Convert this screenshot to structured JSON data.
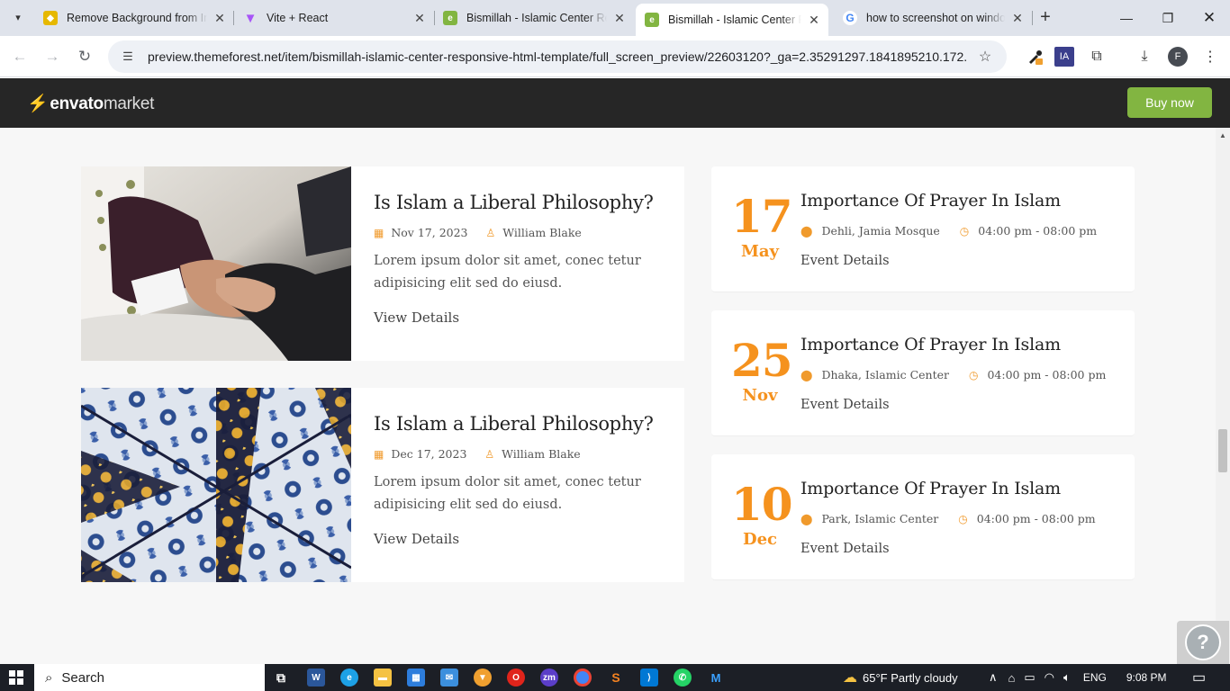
{
  "browser": {
    "tabs": [
      {
        "title": "Remove Background from In",
        "favicon_color": "#e6b800"
      },
      {
        "title": "Vite + React",
        "favicon_color": "#a855f7"
      },
      {
        "title": "Bismillah - Islamic Center Re",
        "favicon_color": "#82b541"
      },
      {
        "title": "Bismillah - Islamic Center Re",
        "favicon_color": "#82b541",
        "active": true
      },
      {
        "title": "how to screenshot on windo",
        "favicon_color": "#4285f4"
      }
    ],
    "url": "preview.themeforest.net/item/bismillah-islamic-center-responsive-html-template/full_screen_preview/22603120?_ga=2.35291297.1841895210.172...",
    "profile_initial": "F",
    "ext_ia": "IA"
  },
  "envato": {
    "logo_bold": "envato",
    "logo_light": "market",
    "buy_now": "Buy now",
    "accent": "#82b541"
  },
  "blogs": [
    {
      "title": "Is Islam a Liberal Philosophy?",
      "date": "Nov 17, 2023",
      "author": "William Blake",
      "excerpt_line1": "Lorem ipsum dolor sit amet, conec tetur",
      "excerpt_line2": "adipisicing elit sed do eiusd.",
      "link": "View Details",
      "image": "handshake-photo"
    },
    {
      "title": "Is Islam a Liberal Philosophy?",
      "date": "Dec 17, 2023",
      "author": "William Blake",
      "excerpt_line1": "Lorem ipsum dolor sit amet, conec tetur",
      "excerpt_line2": "adipisicing elit sed do eiusd.",
      "link": "View Details",
      "image": "islamic-tile-photo"
    }
  ],
  "events": [
    {
      "day": "17",
      "month": "May",
      "title": "Importance Of Prayer In Islam",
      "location": "Dehli, Jamia Mosque",
      "time": "04:00 pm - 08:00 pm",
      "link": "Event Details"
    },
    {
      "day": "25",
      "month": "Nov",
      "title": "Importance Of Prayer In Islam",
      "location": "Dhaka, Islamic Center",
      "time": "04:00 pm - 08:00 pm",
      "link": "Event Details"
    },
    {
      "day": "10",
      "month": "Dec",
      "title": "Importance Of Prayer In Islam",
      "location": "Park, Islamic Center",
      "time": "04:00 pm - 08:00 pm",
      "link": "Event Details"
    }
  ],
  "theme_accent": "#f5921e",
  "taskbar": {
    "search_label": "Search",
    "weather": "65°F  Partly cloudy",
    "language": "ENG",
    "time": "9:08 PM"
  }
}
